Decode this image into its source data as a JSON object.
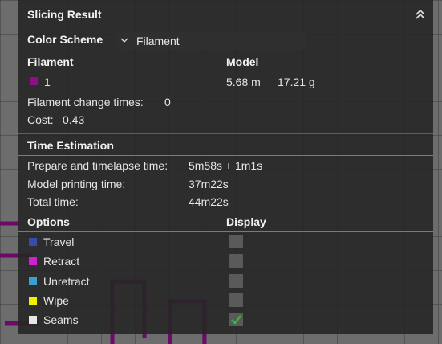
{
  "panel": {
    "title": "Slicing Result",
    "color_scheme_label": "Color Scheme",
    "color_scheme_value": "Filament"
  },
  "filament_table": {
    "col_filament": "Filament",
    "col_model": "Model",
    "row": {
      "swatch_color": "#8b0f86",
      "id": "1",
      "length": "5.68 m",
      "weight": "17.21 g"
    }
  },
  "stats": {
    "change_times_label": "Filament change times:",
    "change_times_value": "0",
    "cost_label": "Cost:",
    "cost_value": "0.43"
  },
  "time_estimation": {
    "header": "Time Estimation",
    "rows": [
      {
        "label": "Prepare and timelapse time:",
        "value": "5m58s + 1m1s"
      },
      {
        "label": "Model printing time:",
        "value": "37m22s"
      },
      {
        "label": "Total time:",
        "value": "44m22s"
      }
    ]
  },
  "options": {
    "col_options": "Options",
    "col_display": "Display",
    "items": [
      {
        "label": "Travel",
        "color": "#3b4aa8",
        "checked": false
      },
      {
        "label": "Retract",
        "color": "#d020d0",
        "checked": false
      },
      {
        "label": "Unretract",
        "color": "#3aa0d0",
        "checked": false
      },
      {
        "label": "Wipe",
        "color": "#f0f000",
        "checked": false
      },
      {
        "label": "Seams",
        "color": "#e6e6e6",
        "checked": true
      }
    ]
  },
  "colors": {
    "check_mark": "#2fbf3f",
    "toolpath": "#6a0b66"
  },
  "icons": {
    "collapse": "double-chevron-up-icon",
    "dropdown": "chevron-down-icon",
    "check": "check-icon"
  }
}
